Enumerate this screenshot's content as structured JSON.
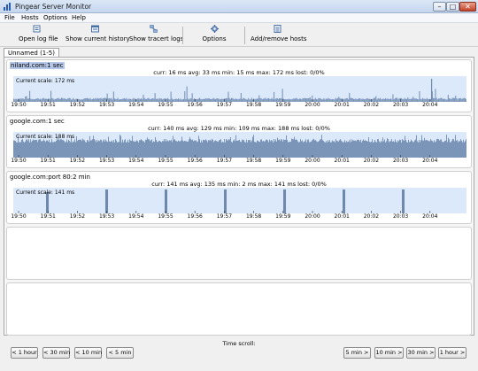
{
  "window": {
    "title": "Pingear Server Monitor",
    "controls": {
      "minimize": "–",
      "maximize": "□",
      "close": "✕"
    }
  },
  "menu": [
    "File",
    "Hosts",
    "Options",
    "Help"
  ],
  "toolbar": {
    "open_log": "Open log file",
    "history": "Show current history",
    "tracert": "Show tracert logs",
    "options": "Options",
    "add_remove": "Add/remove hosts"
  },
  "tab": {
    "label": "Unnamed (1-5)"
  },
  "time_ticks": [
    "19:50",
    "19:51",
    "19:52",
    "19:53",
    "19:54",
    "19:55",
    "19:56",
    "19:57",
    "19:58",
    "19:59",
    "20:00",
    "20:01",
    "20:02",
    "20:03",
    "20:04"
  ],
  "panels": [
    {
      "header": "niland.com:1 sec",
      "stats": "curr: 16 ms   avg: 33 ms   min: 15 ms   max: 172 ms   lost: 0/0%",
      "scale": "Current scale: 172 ms",
      "selected": true
    },
    {
      "header": "google.com:1 sec",
      "stats": "curr: 140 ms   avg: 129 ms   min: 109 ms   max: 188 ms   lost: 0/0%",
      "scale": "Current scale: 188 ms",
      "selected": false
    },
    {
      "header": "google.com:port 80:2 min",
      "stats": "curr: 141 ms   avg: 135 ms   min: 2 ms   max: 141 ms   lost: 0/0%",
      "scale": "Current scale: 141 ms",
      "selected": false
    }
  ],
  "bottom": {
    "time_scroll_label": "Time scroll:",
    "back_buttons": [
      "< 1 hour",
      "< 30 min",
      "< 10 min",
      "< 5 min"
    ],
    "forward_buttons": [
      "5 min >",
      "10 min >",
      "30 min >",
      "1 hour >"
    ]
  },
  "colors": {
    "graph_bg": "#dce9fa",
    "bar": "#7b95b9",
    "bar_dark": "#6f89ad"
  }
}
